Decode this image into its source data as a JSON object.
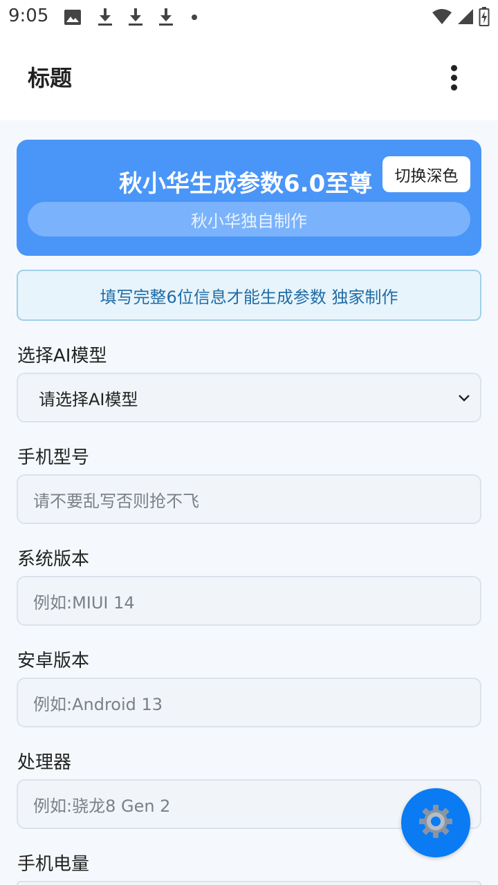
{
  "status_bar": {
    "time": "9:05",
    "left_icons": [
      "image-icon",
      "download-icon",
      "download-icon",
      "download-icon",
      "dot-icon"
    ],
    "right_icons": [
      "wifi-icon",
      "signal-icon",
      "battery-charging-icon"
    ]
  },
  "app_bar": {
    "title": "标题",
    "menu_icon": "more-vert-icon"
  },
  "header": {
    "title": "秋小华生成参数6.0至尊",
    "toggle_label": "切换深色",
    "subtitle": "秋小华独自制作",
    "bg_color": "#4a95f8"
  },
  "notice": {
    "text": "填写完整6位信息才能生成参数 独家制作"
  },
  "form": {
    "ai_model_label": "选择AI模型",
    "ai_model_value": "请选择AI模型",
    "phone_model_label": "手机型号",
    "phone_model_placeholder": "请不要乱写否则抢不飞",
    "system_version_label": "系统版本",
    "system_version_placeholder": "例如:MIUI 14",
    "android_version_label": "安卓版本",
    "android_version_placeholder": "例如:Android 13",
    "processor_label": "处理器",
    "processor_placeholder": "例如:骁龙8 Gen 2",
    "battery_label": "手机电量"
  },
  "fab": {
    "icon": "gear-icon",
    "color": "#0a7bf3"
  }
}
